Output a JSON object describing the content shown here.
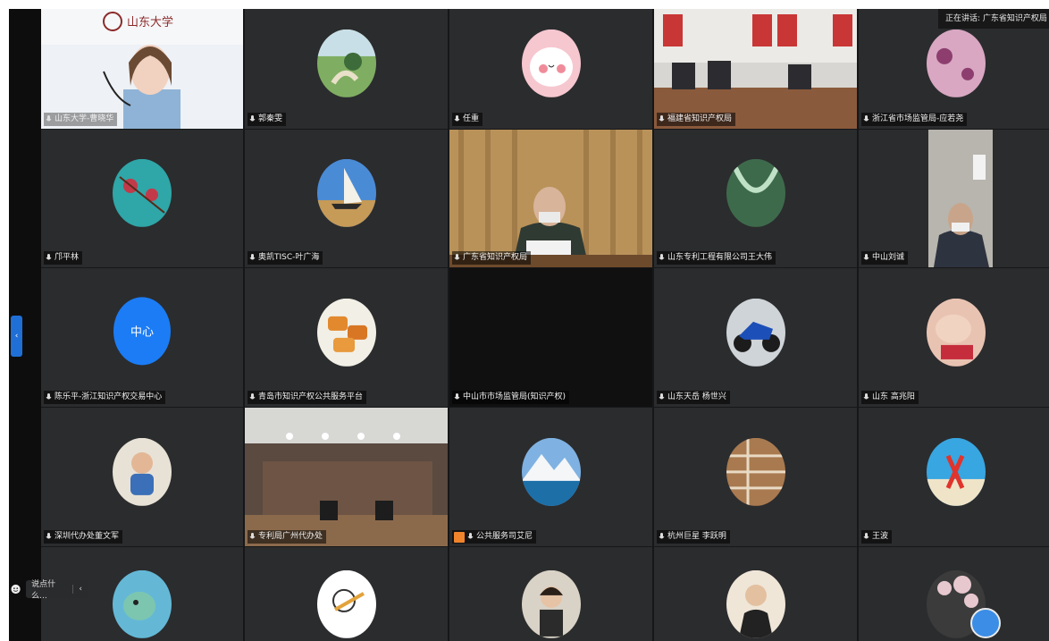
{
  "speaking": "正在讲话: 广东省知识产权局",
  "chat": {
    "placeholder": "说点什么...",
    "collapse_glyph": "‹"
  },
  "sidebar_toggle": "‹",
  "colors": {
    "active_border": "#38b24c",
    "avatar_blue": "#1b7cf5",
    "toggle_blue": "#1f6fd6"
  },
  "tiles": [
    {
      "name": "山东大学-曹晓华",
      "logo_text": "山东大学",
      "kind": "video-office"
    },
    {
      "name": "郭秦雯",
      "kind": "avatar",
      "icon": "park-photo-icon"
    },
    {
      "name": "任重",
      "kind": "avatar",
      "icon": "pink-rabbit-icon"
    },
    {
      "name": "福建省知识产权局",
      "kind": "video-meeting-room"
    },
    {
      "name": "浙江省市场监管局-应若尧",
      "kind": "avatar",
      "icon": "pink-fabric-icon"
    },
    {
      "name": "邝平林",
      "kind": "avatar",
      "icon": "red-plum-icon"
    },
    {
      "name": "奥凯TISC-叶广海",
      "kind": "avatar",
      "icon": "sailboat-icon"
    },
    {
      "name": "广东省知识产权局",
      "kind": "video-speaker",
      "active": true
    },
    {
      "name": "山东专利工程有限公司王大伟",
      "kind": "avatar",
      "icon": "green-glass-icon"
    },
    {
      "name": "中山刘诚",
      "kind": "video-person"
    },
    {
      "name": "陈乐平-浙江知识产权交易中心",
      "kind": "avatar-text",
      "avatar_text": "中心"
    },
    {
      "name": "青岛市知识产权公共服务平台",
      "kind": "avatar",
      "icon": "pastry-icon"
    },
    {
      "name": "中山市市场监管局(知识产权)",
      "kind": "black"
    },
    {
      "name": "山东天岳 杨世兴",
      "kind": "avatar",
      "icon": "motorcycle-icon"
    },
    {
      "name": "山东 高兆阳",
      "kind": "avatar",
      "icon": "hand-gift-icon"
    },
    {
      "name": "深圳代办处董文军",
      "kind": "avatar",
      "icon": "baby-photo-icon"
    },
    {
      "name": "专利局广州代办处",
      "kind": "video-room-wide"
    },
    {
      "name": "公共服务司艾尼",
      "kind": "avatar",
      "icon": "mountain-lake-icon",
      "badge": true
    },
    {
      "name": "杭州巨星 李跃明",
      "kind": "avatar",
      "icon": "bookshelf-icon"
    },
    {
      "name": "王波",
      "kind": "avatar",
      "icon": "beach-flag-icon"
    },
    {
      "name": "",
      "kind": "avatar",
      "icon": "cartoon-monster-icon"
    },
    {
      "name": "",
      "kind": "avatar",
      "icon": "cartoon-flute-icon"
    },
    {
      "name": "",
      "kind": "avatar",
      "icon": "child-photo-icon"
    },
    {
      "name": "",
      "kind": "avatar",
      "icon": "man-suit-icon"
    },
    {
      "name": "",
      "kind": "avatar",
      "icon": "cherry-blossom-icon"
    }
  ]
}
